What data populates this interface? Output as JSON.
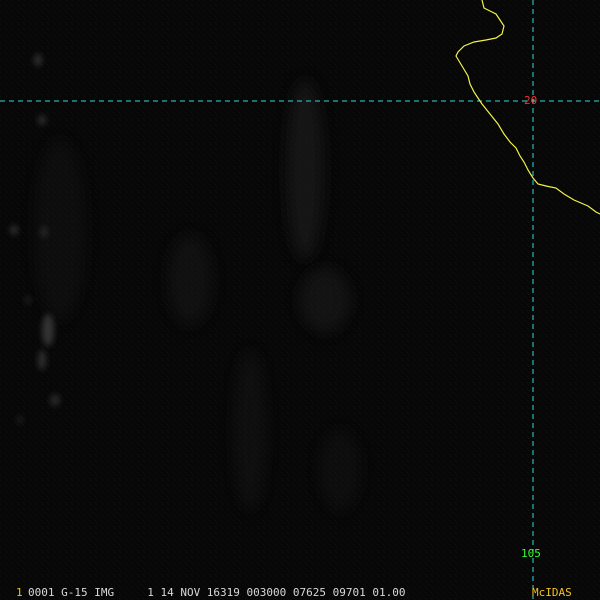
{
  "overlay": {
    "latitude_label": "20",
    "longitude_label": "105",
    "grid_color": "#2fd8d8",
    "latitude_color": "#ff2a2a",
    "longitude_color": "#33ff33",
    "coastline_color": "#f2f24a"
  },
  "status": {
    "frame_number": "1",
    "frame_color": "#f2c21e",
    "image_info": "0001 G-15 IMG     1 14 NOV 16319 003000 07625 09701 01.00",
    "source": "McIDAS",
    "source_color": "#f2c21e"
  }
}
